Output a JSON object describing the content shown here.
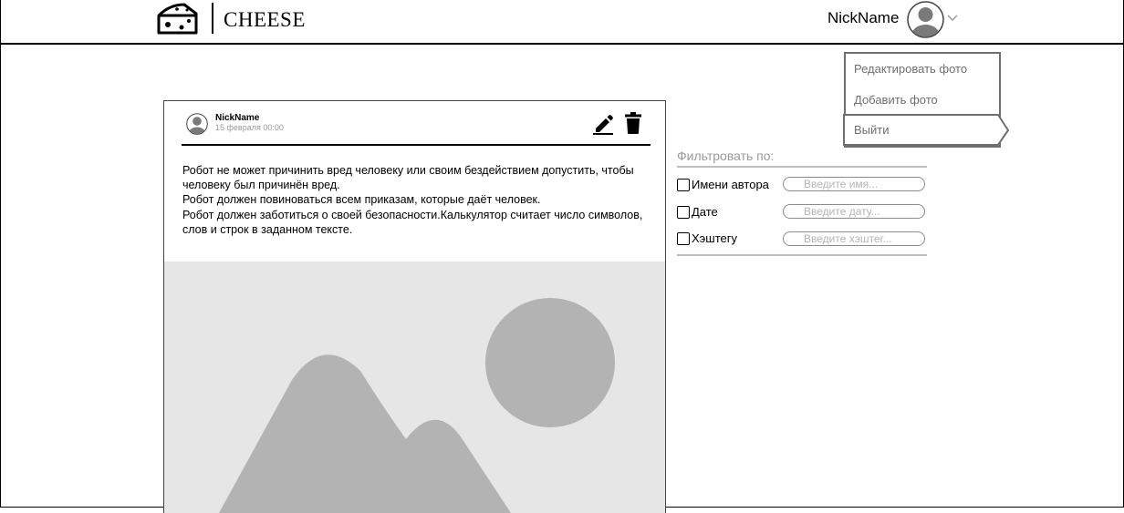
{
  "header": {
    "brand": "CHEESE",
    "username": "NickName"
  },
  "user_menu": {
    "items": [
      "Редактировать фото",
      "Добавить фото",
      "Выйти"
    ]
  },
  "post": {
    "author": "NickName",
    "date": "15 февраля 00:00",
    "lines": [
      "Робот не может причинить вред человеку или своим бездействием допустить, чтобы",
      "человеку был причинён вред.",
      "Робот должен повиноваться всем приказам, которые даёт человек.",
      "Робот должен заботиться о своей безопасности.Калькулятор считает число символов,",
      "слов и строк в заданном тексте."
    ]
  },
  "filter": {
    "title": "Фильтровать по:",
    "options": [
      {
        "label": "Имени автора",
        "placeholder": "Введите имя..."
      },
      {
        "label": "Дате",
        "placeholder": "Введите дату..."
      },
      {
        "label": "Хэштегу",
        "placeholder": "Введите хэштег..."
      }
    ]
  },
  "colors": {
    "border": "#000000",
    "muted_text": "#6f6f6f",
    "placeholder_gray": "#e6e6e6",
    "placeholder_shape": "#b3b3b3"
  }
}
